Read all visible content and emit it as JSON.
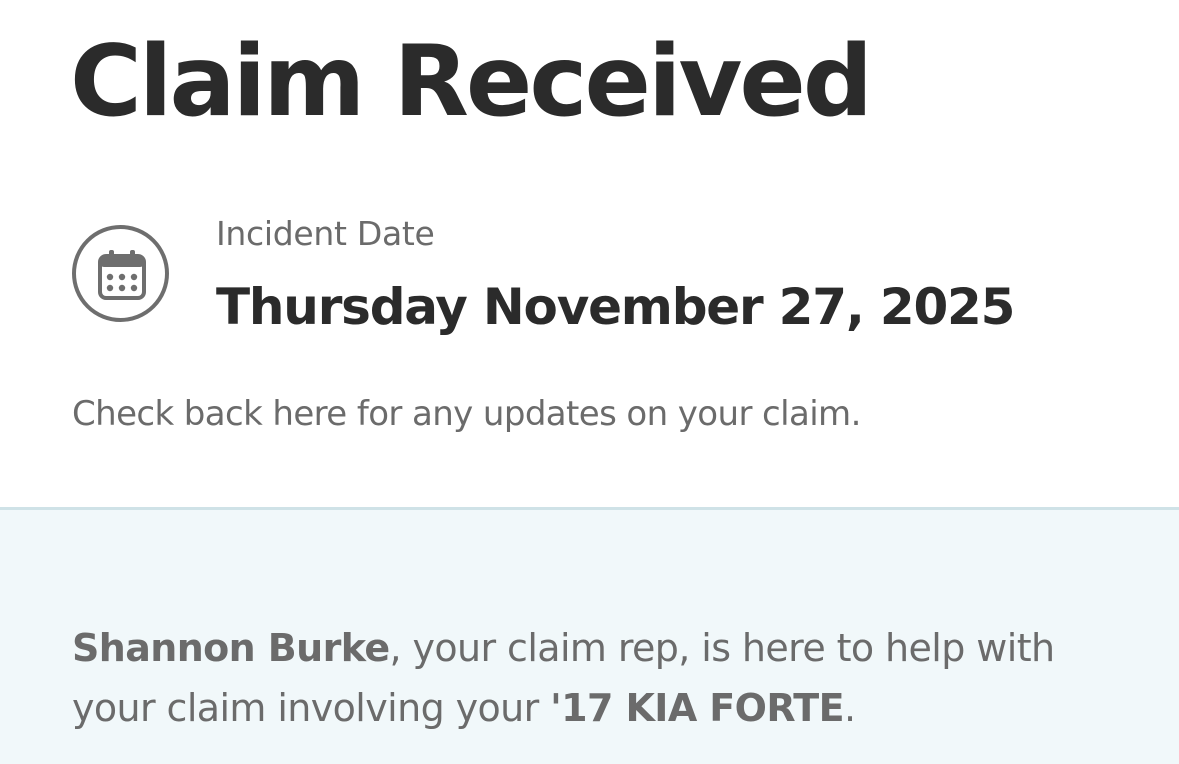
{
  "claim": {
    "title": "Claim Received",
    "incident_label": "Incident Date",
    "incident_date": "Thursday November 27, 2025",
    "update_message": "Check back here for any updates on your claim."
  },
  "rep": {
    "name": "Shannon Burke",
    "text_after_name": ", your claim rep, is here to help with your claim involving your ",
    "vehicle": "'17 KIA FORTE",
    "text_end": "."
  },
  "icons": {
    "incident": "calendar-icon"
  },
  "colors": {
    "heading": "#2b2b2b",
    "secondary_text": "#6b6b6b",
    "panel_background": "#f1f8fa",
    "panel_border": "#cfe2e7"
  }
}
